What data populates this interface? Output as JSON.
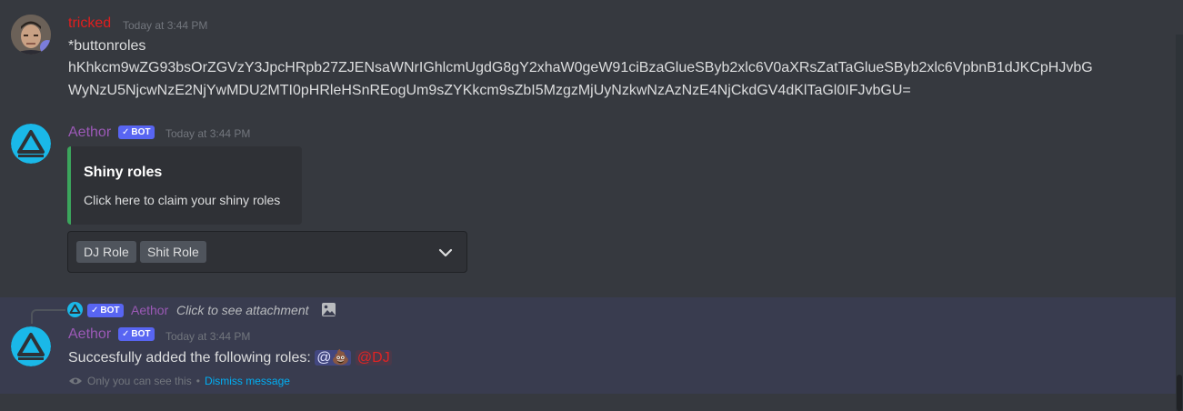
{
  "messages": {
    "tricked": {
      "username": "tricked",
      "timestamp": "Today at 3:44 PM",
      "line1": "*buttonroles",
      "line2": "hKhkcm9wZG93bsOrZGVzY3JpcHRpb27ZJENsaWNrIGhlcmUgdG8gY2xhaW0geW91ciBzaGlueSByb2xlc6V0aXRsZatTaGlueSByb2xlc6VpbnB1dJKCpHJvbG",
      "line3": "WyNzU5NjcwNzE2NjYwMDU2MTI0pHRleHSnREogUm9sZYKkcm9sZbI5MzgzMjUyNzkwNzAzNzE4NjCkdGV4dKlTaGl0IFJvbGU="
    },
    "aethor1": {
      "username": "Aethor",
      "bot_label": "BOT",
      "timestamp": "Today at 3:44 PM",
      "embed_title": "Shiny roles",
      "embed_desc": "Click here to claim your shiny roles",
      "select_chips": [
        "DJ Role",
        "Shit Role"
      ]
    },
    "aethor2": {
      "reply_username": "Aethor",
      "reply_text": "Click to see attachment",
      "username": "Aethor",
      "bot_label": "BOT",
      "timestamp": "Today at 3:44 PM",
      "content_prefix": "Succesfully added the following roles:",
      "mention_at": "@",
      "mention_emoji": "💩",
      "role_dj": "@DJ",
      "ephemeral_note": "Only you can see this",
      "dismiss": "Dismiss message"
    }
  },
  "colors": {
    "tricked_name": "#e01e1e",
    "aethor_name": "#9b59b6",
    "bot_badge": "#5865f2",
    "embed_accent": "#3ba55c",
    "link": "#00aff4"
  }
}
